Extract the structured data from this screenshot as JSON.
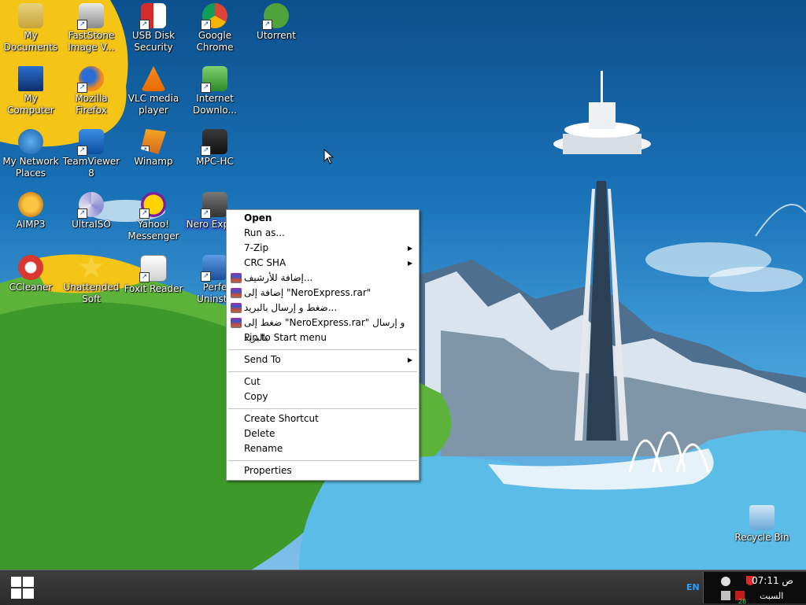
{
  "desktop_icons": [
    {
      "label": "My Documents",
      "icon": "folder-icon"
    },
    {
      "label": "FastStone Image V...",
      "icon": "faststone-icon"
    },
    {
      "label": "USB Disk Security",
      "icon": "usb-disk-security-icon"
    },
    {
      "label": "Google Chrome",
      "icon": "chrome-icon"
    },
    {
      "label": "Utorrent",
      "icon": "utorrent-icon"
    },
    {
      "label": "My Computer",
      "icon": "computer-icon"
    },
    {
      "label": "Mozilla Firefox",
      "icon": "firefox-icon"
    },
    {
      "label": "VLC media player",
      "icon": "vlc-icon"
    },
    {
      "label": "Internet Downlo...",
      "icon": "idm-icon"
    },
    {
      "label": "My Network Places",
      "icon": "network-icon"
    },
    {
      "label": "TeamViewer 8",
      "icon": "teamviewer-icon"
    },
    {
      "label": "Winamp",
      "icon": "winamp-icon"
    },
    {
      "label": "MPC-HC",
      "icon": "mpc-hc-icon"
    },
    {
      "label": "AIMP3",
      "icon": "aimp-icon"
    },
    {
      "label": "UltraISO",
      "icon": "ultraiso-icon"
    },
    {
      "label": "Yahoo! Messenger",
      "icon": "yahoo-messenger-icon"
    },
    {
      "label": "Nero Expres",
      "icon": "nero-icon"
    },
    {
      "label": "CCleaner",
      "icon": "ccleaner-icon"
    },
    {
      "label": "Unattended Soft",
      "icon": "star-icon"
    },
    {
      "label": "Foxit Reader",
      "icon": "foxit-icon"
    },
    {
      "label": "Perfe Uninsta",
      "icon": "uninstaller-icon"
    },
    {
      "label": "Recycle Bin",
      "icon": "recycle-bin-icon"
    }
  ],
  "context_menu": {
    "open": "Open",
    "run_as": "Run as...",
    "zip7": "7-Zip",
    "crc": "CRC SHA",
    "rar_add": "إضافة للأرشيف...",
    "rar_add_named": "إضافة إلى \"NeroExpress.rar\"",
    "rar_email": "ضغط و إرسال بالبريد...",
    "rar_email_named": "ضغط إلى \"NeroExpress.rar\" و إرسال بالبريد",
    "pin": "Pin to Start menu",
    "send_to": "Send To",
    "cut": "Cut",
    "copy": "Copy",
    "create_shortcut": "Create Shortcut",
    "delete": "Delete",
    "rename": "Rename",
    "properties": "Properties"
  },
  "taskbar": {
    "language": "EN",
    "time": "07:11 ص",
    "day": "السبت",
    "badge": "28"
  },
  "colors": {
    "selection": "#3169c6",
    "taskbar": "#2a2a2a",
    "menu_bg": "#ffffff"
  }
}
